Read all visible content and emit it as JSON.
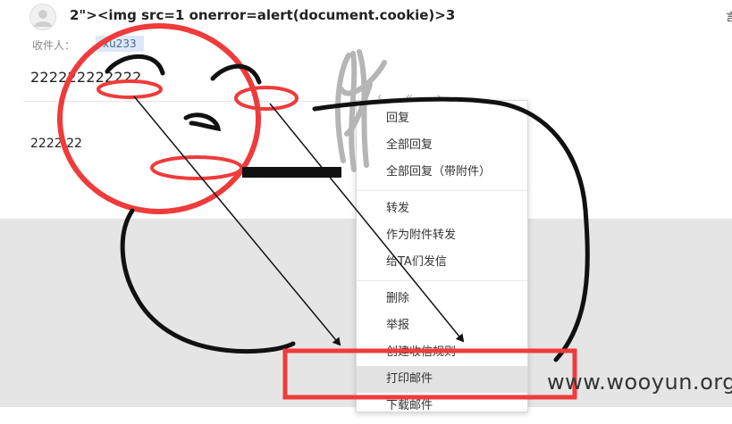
{
  "email": {
    "subject": "2\"><img src=1 onerror=alert(document.cookie)>3",
    "recipient_label": "收件人：",
    "recipient_chip": "xu233",
    "preview": "222222222222",
    "body": "2222.22",
    "edge_char": "言"
  },
  "context_menu": {
    "groups": [
      [
        {
          "label": "回复"
        },
        {
          "label": "全部回复"
        },
        {
          "label": "全部回复（带附件）"
        }
      ],
      [
        {
          "label": "转发"
        },
        {
          "label": "作为附件转发"
        },
        {
          "label": "给TA们发信"
        }
      ],
      [
        {
          "label": "删除"
        },
        {
          "label": "举报"
        },
        {
          "label": "创建收信规则"
        },
        {
          "label": "打印邮件",
          "highlighted": true
        },
        {
          "label": "下载邮件"
        }
      ]
    ]
  },
  "watermark": "www.wooyun.org",
  "colors": {
    "annotation_red": "#ef3b3b",
    "menu_highlight": "#e2e2e2"
  }
}
